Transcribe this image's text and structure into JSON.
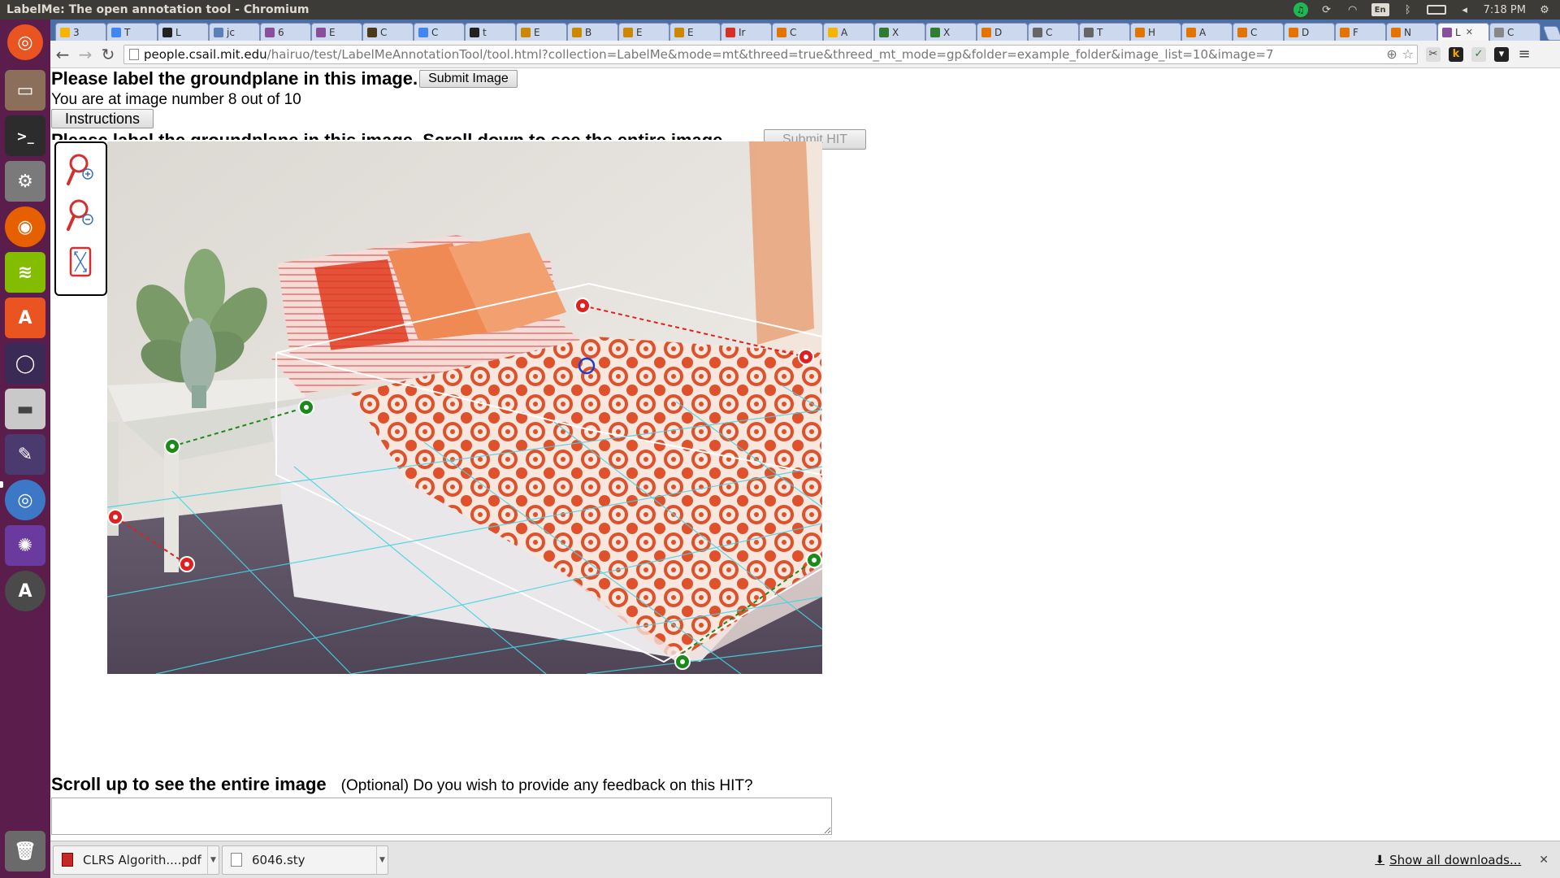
{
  "window": {
    "title": "LabelMe: The open annotation tool - Chromium"
  },
  "panel": {
    "clock": "7:18 PM",
    "keyboard": "En"
  },
  "tabs": [
    {
      "label": "3",
      "color": "#f4b400"
    },
    {
      "label": "T",
      "color": "#4285f4"
    },
    {
      "label": "L",
      "color": "#222222"
    },
    {
      "label": "jc",
      "color": "#5b7fb7"
    },
    {
      "label": "6",
      "color": "#8a4f9c"
    },
    {
      "label": "E",
      "color": "#8a4f9c"
    },
    {
      "label": "C",
      "color": "#4a3b1c"
    },
    {
      "label": "C",
      "color": "#4285f4"
    },
    {
      "label": "t",
      "color": "#222222"
    },
    {
      "label": "E",
      "color": "#cc8800"
    },
    {
      "label": "B",
      "color": "#cc8800"
    },
    {
      "label": "E",
      "color": "#cc8800"
    },
    {
      "label": "E",
      "color": "#cc8800"
    },
    {
      "label": "Ir",
      "color": "#d93025"
    },
    {
      "label": "C",
      "color": "#e37400"
    },
    {
      "label": "A",
      "color": "#f4b400"
    },
    {
      "label": "X",
      "color": "#2e7d32"
    },
    {
      "label": "X",
      "color": "#2e7d32"
    },
    {
      "label": "D",
      "color": "#e37400"
    },
    {
      "label": "C",
      "color": "#666666"
    },
    {
      "label": "T",
      "color": "#666666"
    },
    {
      "label": "H",
      "color": "#e37400"
    },
    {
      "label": "A",
      "color": "#e37400"
    },
    {
      "label": "C",
      "color": "#e37400"
    },
    {
      "label": "D",
      "color": "#e37400"
    },
    {
      "label": "F",
      "color": "#e37400"
    },
    {
      "label": "N",
      "color": "#e37400"
    },
    {
      "label": "L",
      "color": "#8a4f9c",
      "active": true
    },
    {
      "label": "C",
      "color": "#888888"
    }
  ],
  "address_bar": {
    "host": "people.csail.mit.edu",
    "path": "/hairuo/test/LabelMeAnnotationTool/tool.html?collection=LabelMe&mode=mt&threed=true&threed_mt_mode=gp&folder=example_folder&image_list=10&image=7"
  },
  "page": {
    "heading": "Please label the groundplane in this image.",
    "submit_image_label": "Submit Image",
    "image_position": "You are at image number 8 out of 10",
    "instructions_label": "Instructions",
    "heading2": "Please label the groundplane in this image. Scroll down to see the entire image.",
    "submit_hit_label": "Submit HIT",
    "footer_heading": "Scroll up to see the entire image",
    "feedback_question": "(Optional) Do you wish to provide any feedback on this HIT?",
    "feedback_value": ""
  },
  "downloads": [
    {
      "name": "CLRS Algorith....pdf",
      "type": "pdf"
    },
    {
      "name": "6046.sty",
      "type": "doc"
    }
  ],
  "show_all_downloads": "Show all downloads..."
}
